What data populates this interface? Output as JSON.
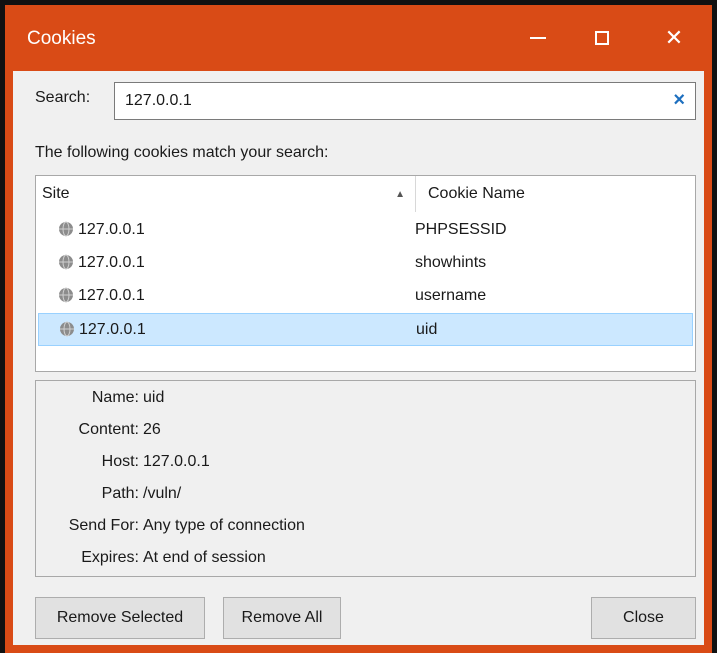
{
  "window": {
    "title": "Cookies",
    "close_glyph": "✕"
  },
  "search": {
    "label": "Search:",
    "value": "127.0.0.1",
    "clear_glyph": "×"
  },
  "match_label": "The following cookies match your search:",
  "table": {
    "columns": [
      "Site",
      "Cookie Name"
    ],
    "sort_glyph": "▲",
    "rows": [
      {
        "site": "127.0.0.1",
        "cookie": "PHPSESSID"
      },
      {
        "site": "127.0.0.1",
        "cookie": "showhints"
      },
      {
        "site": "127.0.0.1",
        "cookie": "username"
      },
      {
        "site": "127.0.0.1",
        "cookie": "uid"
      }
    ]
  },
  "details": [
    {
      "key": "Name:",
      "value": "uid"
    },
    {
      "key": "Content:",
      "value": "26"
    },
    {
      "key": "Host:",
      "value": "127.0.0.1"
    },
    {
      "key": "Path:",
      "value": "/vuln/"
    },
    {
      "key": "Send For:",
      "value": "Any type of connection"
    },
    {
      "key": "Expires:",
      "value": "At end of session"
    }
  ],
  "buttons": {
    "remove_selected": "Remove Selected",
    "remove_all": "Remove All",
    "close": "Close"
  },
  "colors": {
    "accent": "#d94b16",
    "selection": "#cce8ff",
    "clear_icon": "#1d6fbf"
  }
}
